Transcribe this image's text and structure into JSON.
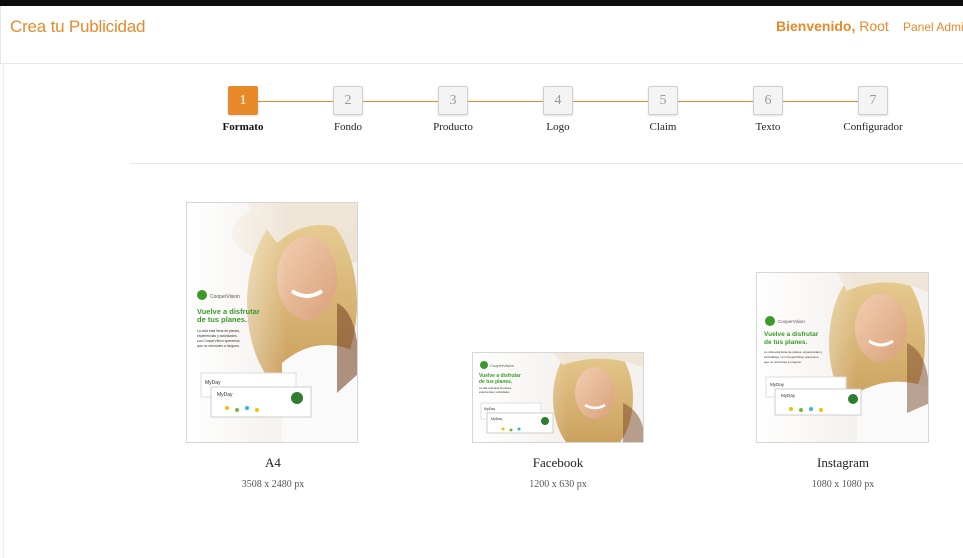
{
  "header": {
    "brand": "Crea tu Publicidad",
    "welcome_prefix": "Bienvenido,",
    "user": "Root",
    "panel_link": "Panel Admin"
  },
  "steps": [
    {
      "num": "1",
      "label": "Formato",
      "active": true
    },
    {
      "num": "2",
      "label": "Fondo",
      "active": false
    },
    {
      "num": "3",
      "label": "Producto",
      "active": false
    },
    {
      "num": "4",
      "label": "Logo",
      "active": false
    },
    {
      "num": "5",
      "label": "Claim",
      "active": false
    },
    {
      "num": "6",
      "label": "Texto",
      "active": false
    },
    {
      "num": "7",
      "label": "Configurador",
      "active": false
    }
  ],
  "formats": [
    {
      "name": "A4",
      "size": "3508 x 2480 px"
    },
    {
      "name": "Facebook",
      "size": "1200 x 630 px"
    },
    {
      "name": "Instagram",
      "size": "1080 x 1080 px"
    }
  ],
  "ad": {
    "logo": "CooperVision",
    "headline_1": "Vuelve a disfrutar",
    "headline_2": "de tus planes.",
    "product": "MyDay",
    "body_lines": [
      "La vida está llena de planes,",
      "experiencias y actividades,",
      "con CooperVision queremos",
      "que no renuncies a ninguno."
    ]
  },
  "colors": {
    "accent": "#e8892a",
    "ad_green": "#3a9a2a"
  }
}
